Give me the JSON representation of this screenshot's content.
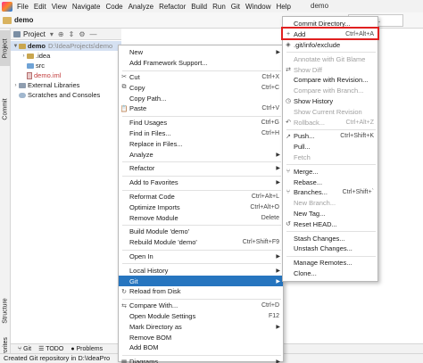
{
  "menubar": {
    "items": [
      "File",
      "Edit",
      "View",
      "Navigate",
      "Code",
      "Analyze",
      "Refactor",
      "Build",
      "Run",
      "Git",
      "Window",
      "Help"
    ],
    "window_title": "demo"
  },
  "navbar": {
    "project": "demo",
    "run_config": "uration..."
  },
  "left_strip": {
    "project": "Project",
    "commit": "Commit",
    "structure": "Structure",
    "favorites": "Favorites"
  },
  "project_panel": {
    "title": "Project",
    "tree": [
      {
        "label": "demo",
        "path": "D:\\IdeaProjects\\demo"
      },
      {
        "label": ".idea"
      },
      {
        "label": "src"
      },
      {
        "label": "demo.iml"
      },
      {
        "label": "External Libraries"
      },
      {
        "label": "Scratches and Consoles"
      }
    ]
  },
  "bottom_tabs": [
    "Git",
    "TODO",
    "Problems"
  ],
  "status": {
    "text": "Created Git repository in D:\\IdeaPro"
  },
  "context_menu": [
    {
      "label": "New",
      "shortcut": "",
      "sub": true
    },
    {
      "label": "Add Framework Support...",
      "shortcut": ""
    },
    {
      "label": "Cut",
      "shortcut": "Ctrl+X",
      "icon": "scissors-icon",
      "glyph": "✂",
      "sep_before": true
    },
    {
      "label": "Copy",
      "shortcut": "Ctrl+C",
      "icon": "copy-icon",
      "glyph": "⧉"
    },
    {
      "label": "Copy Path...",
      "shortcut": ""
    },
    {
      "label": "Paste",
      "shortcut": "Ctrl+V",
      "icon": "paste-icon",
      "glyph": "📋"
    },
    {
      "label": "Find Usages",
      "shortcut": "Ctrl+G",
      "sep_before": true
    },
    {
      "label": "Find in Files...",
      "shortcut": "Ctrl+H"
    },
    {
      "label": "Replace in Files...",
      "shortcut": ""
    },
    {
      "label": "Analyze",
      "shortcut": "",
      "sub": true
    },
    {
      "label": "Refactor",
      "shortcut": "",
      "sub": true,
      "sep_before": true
    },
    {
      "label": "Add to Favorites",
      "shortcut": "",
      "sub": true,
      "sep_before": true
    },
    {
      "label": "Reformat Code",
      "shortcut": "Ctrl+Alt+L",
      "sep_before": true
    },
    {
      "label": "Optimize Imports",
      "shortcut": "Ctrl+Alt+O"
    },
    {
      "label": "Remove Module",
      "shortcut": "Delete"
    },
    {
      "label": "Build Module 'demo'",
      "shortcut": "",
      "sep_before": true
    },
    {
      "label": "Rebuild Module 'demo'",
      "shortcut": "Ctrl+Shift+F9"
    },
    {
      "label": "Open In",
      "shortcut": "",
      "sub": true,
      "sep_before": true
    },
    {
      "label": "Local History",
      "shortcut": "",
      "sub": true,
      "sep_before": true
    },
    {
      "label": "Git",
      "shortcut": "",
      "sub": true,
      "highlight": true
    },
    {
      "label": "Reload from Disk",
      "shortcut": "",
      "icon": "reload-icon",
      "glyph": "↻"
    },
    {
      "label": "Compare With...",
      "shortcut": "Ctrl+D",
      "icon": "compare-icon",
      "glyph": "⇆",
      "sep_before": true
    },
    {
      "label": "Open Module Settings",
      "shortcut": "F12"
    },
    {
      "label": "Mark Directory as",
      "shortcut": "",
      "sub": true
    },
    {
      "label": "Remove BOM",
      "shortcut": ""
    },
    {
      "label": "Add BOM",
      "shortcut": ""
    },
    {
      "label": "Diagrams",
      "shortcut": "",
      "sub": true,
      "icon": "diagram-icon",
      "glyph": "▦",
      "sep_before": true
    }
  ],
  "git_menu": [
    {
      "label": "Commit Directory...",
      "shortcut": ""
    },
    {
      "label": "Add",
      "shortcut": "Ctrl+Alt+A",
      "icon": "plus-icon",
      "glyph": "+"
    },
    {
      "label": ".git/info/exclude",
      "shortcut": "",
      "icon": "git-exclude-icon",
      "glyph": "◈"
    },
    {
      "label": "Annotate with Git Blame",
      "shortcut": "",
      "disabled": true,
      "sep_before": true
    },
    {
      "label": "Show Diff",
      "shortcut": "",
      "disabled": true,
      "icon": "diff-icon",
      "glyph": "⇄"
    },
    {
      "label": "Compare with Revision...",
      "shortcut": ""
    },
    {
      "label": "Compare with Branch...",
      "shortcut": "",
      "disabled": true
    },
    {
      "label": "Show History",
      "shortcut": "",
      "icon": "history-icon",
      "glyph": "◷"
    },
    {
      "label": "Show Current Revision",
      "shortcut": "",
      "disabled": true
    },
    {
      "label": "Rollback...",
      "shortcut": "Ctrl+Alt+Z",
      "disabled": true,
      "icon": "rollback-icon",
      "glyph": "↶"
    },
    {
      "label": "Push...",
      "shortcut": "Ctrl+Shift+K",
      "icon": "push-icon",
      "glyph": "↗",
      "sep_before": true
    },
    {
      "label": "Pull...",
      "shortcut": ""
    },
    {
      "label": "Fetch",
      "shortcut": "",
      "disabled": true
    },
    {
      "label": "Merge...",
      "shortcut": "",
      "icon": "merge-icon",
      "glyph": "⑂",
      "sep_before": true
    },
    {
      "label": "Rebase...",
      "shortcut": ""
    },
    {
      "label": "Branches...",
      "shortcut": "Ctrl+Shift+`",
      "icon": "branch-icon",
      "glyph": "⑂"
    },
    {
      "label": "New Branch...",
      "shortcut": "",
      "disabled": true
    },
    {
      "label": "New Tag...",
      "shortcut": ""
    },
    {
      "label": "Reset HEAD...",
      "shortcut": "",
      "icon": "reset-icon",
      "glyph": "↺"
    },
    {
      "label": "Stash Changes...",
      "shortcut": "",
      "sep_before": true
    },
    {
      "label": "Unstash Changes...",
      "shortcut": ""
    },
    {
      "label": "Manage Remotes...",
      "shortcut": "",
      "sep_before": true
    },
    {
      "label": "Clone...",
      "shortcut": ""
    }
  ],
  "colors": {
    "highlight": "#2675bf",
    "callout": "#e02020",
    "tree_selection": "#d5e1f2"
  }
}
